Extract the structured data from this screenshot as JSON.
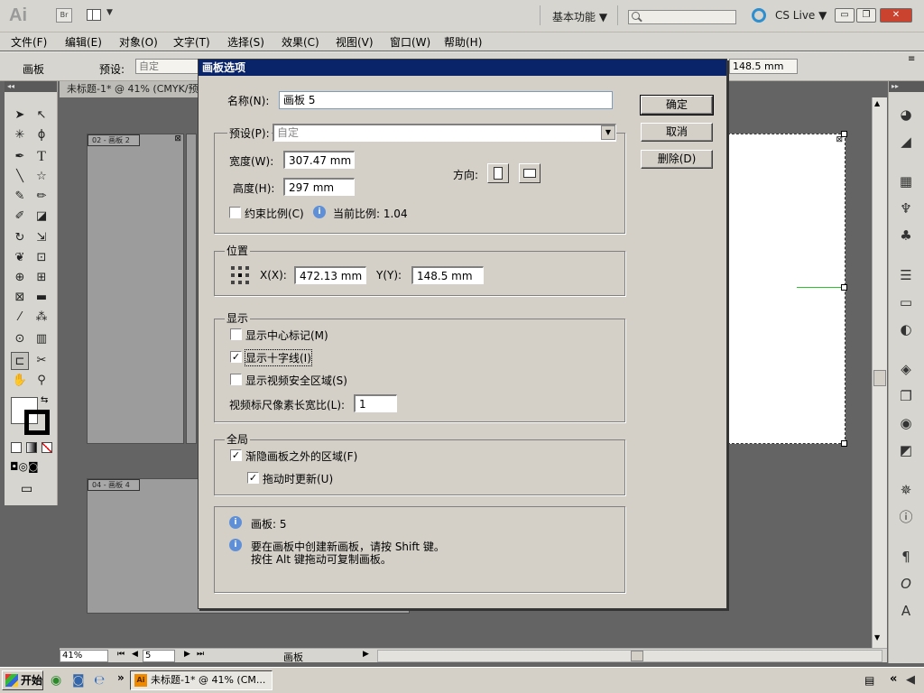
{
  "app": {
    "logo": "Ai",
    "bridge_label": "Br",
    "workspace": "基本功能 ▼",
    "cs_live": "CS Live ▼",
    "window_buttons": {
      "minimize": "▭",
      "restore": "❐",
      "close": "✕"
    }
  },
  "menu": [
    "文件(F)",
    "编辑(E)",
    "对象(O)",
    "文字(T)",
    "选择(S)",
    "效果(C)",
    "视图(V)",
    "窗口(W)",
    "帮助(H)"
  ],
  "control_bar": {
    "panel_label": "画板",
    "preset_label": "预设:",
    "preset_value": "自定",
    "y_value": "148.5 mm",
    "menu_icon": "≡"
  },
  "document": {
    "tab_title": "未标题-1* @ 41% (CMYK/预",
    "artboards": [
      {
        "label": "02 - 画板 2"
      },
      {
        "label": "04 - 画板 4"
      }
    ],
    "zoom": "41%",
    "page": "5",
    "status": "画板"
  },
  "dialog": {
    "title": "画板选项",
    "name_label": "名称(N):",
    "name_value": "画板 5",
    "ok": "确定",
    "cancel": "取消",
    "delete": "删除(D)",
    "preset_label": "预设(P):",
    "preset_value": "自定",
    "width_label": "宽度(W):",
    "width_value": "307.47 mm",
    "height_label": "高度(H):",
    "height_value": "297 mm",
    "orientation_label": "方向:",
    "constrain_label": "约束比例(C)",
    "ratio_label": "当前比例: 1.04",
    "position_group": "位置",
    "x_label": "X(X):",
    "x_value": "472.13 mm",
    "y_label": "Y(Y):",
    "y_value": "148.5 mm",
    "display_group": "显示",
    "show_center": "显示中心标记(M)",
    "show_cross": "显示十字线(I)",
    "show_safe": "显示视频安全区域(S)",
    "pixel_ratio_label": "视频标尺像素长宽比(L):",
    "pixel_ratio_value": "1",
    "global_group": "全局",
    "fade_label": "渐隐画板之外的区域(F)",
    "update_label": "拖动时更新(U)",
    "info_artboard": "画板: 5",
    "info_line1": "要在画板中创建新画板，请按 Shift 键。",
    "info_line2": "按住 Alt 键拖动可复制画板。",
    "checks": {
      "constrain": false,
      "center": false,
      "cross": true,
      "safe": false,
      "fade": true,
      "update": true
    }
  },
  "taskbar": {
    "start": "开始",
    "task_title": "未标题-1* @ 41% (CM...",
    "chevron": "»"
  }
}
